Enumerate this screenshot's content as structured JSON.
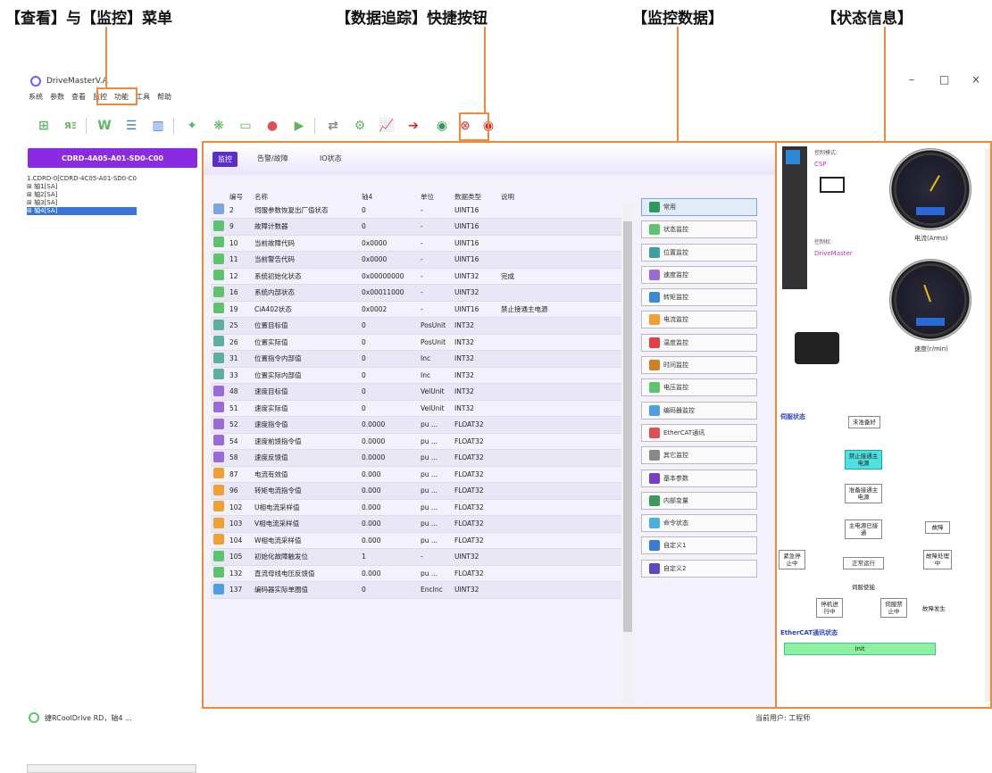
{
  "annotations": {
    "menu": "【查看】与【监控】菜单",
    "trace": "【数据追踪】快捷按钮",
    "monitor": "【监控数据】",
    "status": "【状态信息】"
  },
  "window": {
    "title": "DriveMasterV.A",
    "minimize": "–",
    "maximize": "□",
    "close": "×"
  },
  "menu": [
    "系统",
    "参数",
    "查看",
    "监控",
    "功能",
    "工具",
    "帮助"
  ],
  "device_button": "CDRD-4A05-A01-SD0-C00",
  "tree": {
    "root": "1.CDRD-0[CDRD-4C05-A01-SD0-C0",
    "items": [
      "⊞ 轴1[SA]",
      "⊞ 轴2[SA]",
      "⊞ 轴3[SA]",
      "⊞ 轴4[SA]"
    ]
  },
  "tabs": [
    "监控",
    "告警/故障",
    "IO状态"
  ],
  "table": {
    "headers": [
      "编号",
      "名称",
      "轴4",
      "单位",
      "数据类型",
      "说明"
    ],
    "rows": [
      [
        "2",
        "伺服参数恢复出厂值状态",
        "0",
        "-",
        "UINT16",
        ""
      ],
      [
        "9",
        "故障计数器",
        "0",
        "-",
        "UINT16",
        ""
      ],
      [
        "10",
        "当前故障代码",
        "0x0000",
        "-",
        "UINT16",
        ""
      ],
      [
        "11",
        "当前警告代码",
        "0x0000",
        "-",
        "UINT16",
        ""
      ],
      [
        "12",
        "系统初始化状态",
        "0x00000000",
        "-",
        "UINT32",
        "完成"
      ],
      [
        "16",
        "系统内部状态",
        "0x00011000",
        "-",
        "UINT32",
        ""
      ],
      [
        "19",
        "CiA402状态",
        "0x0002",
        "-",
        "UINT16",
        "禁止接通主电源"
      ],
      [
        "25",
        "位置目标值",
        "0",
        "PosUnit",
        "INT32",
        ""
      ],
      [
        "26",
        "位置实际值",
        "0",
        "PosUnit",
        "INT32",
        ""
      ],
      [
        "31",
        "位置指令内部值",
        "0",
        "Inc",
        "INT32",
        ""
      ],
      [
        "33",
        "位置实际内部值",
        "0",
        "Inc",
        "INT32",
        ""
      ],
      [
        "48",
        "速度目标值",
        "0",
        "VelUnit",
        "INT32",
        ""
      ],
      [
        "51",
        "速度实际值",
        "0",
        "VelUnit",
        "INT32",
        ""
      ],
      [
        "52",
        "速度指令值",
        "0.0000",
        "pu ...",
        "FLOAT32",
        ""
      ],
      [
        "54",
        "速度前馈指令值",
        "0.0000",
        "pu ...",
        "FLOAT32",
        ""
      ],
      [
        "58",
        "速度反馈值",
        "0.0000",
        "pu ...",
        "FLOAT32",
        ""
      ],
      [
        "87",
        "电流有效值",
        "0.000",
        "pu ...",
        "FLOAT32",
        ""
      ],
      [
        "96",
        "转矩电流指令值",
        "0.000",
        "pu ...",
        "FLOAT32",
        ""
      ],
      [
        "102",
        "U相电流采样值",
        "0.000",
        "pu ...",
        "FLOAT32",
        ""
      ],
      [
        "103",
        "V相电流采样值",
        "0.000",
        "pu ...",
        "FLOAT32",
        ""
      ],
      [
        "104",
        "W相电流采样值",
        "0.000",
        "pu ...",
        "FLOAT32",
        ""
      ],
      [
        "105",
        "初始化故障触发位",
        "1",
        "-",
        "UINT32",
        ""
      ],
      [
        "132",
        "直流母线电压反馈值",
        "0.000",
        "pu ...",
        "FLOAT32",
        ""
      ],
      [
        "137",
        "编码器实际单圈值",
        "0",
        "EncInc",
        "UINT32",
        ""
      ]
    ],
    "row_colors": [
      "#7aa7e0",
      "#5cc46a",
      "#5cc46a",
      "#5cc46a",
      "#5cc46a",
      "#5cc46a",
      "#5cc46a",
      "#5cb0a0",
      "#5cb0a0",
      "#5cb0a0",
      "#5cb0a0",
      "#9a6ad8",
      "#9a6ad8",
      "#9a6ad8",
      "#9a6ad8",
      "#9a6ad8",
      "#f0a030",
      "#f0a030",
      "#f0a030",
      "#f0a030",
      "#f0a030",
      "#5cc46a",
      "#5cc46a",
      "#4aa0e0"
    ]
  },
  "monitor_buttons": [
    {
      "label": "常用",
      "color": "#2a9a5a"
    },
    {
      "label": "状态监控",
      "color": "#5cc46a"
    },
    {
      "label": "位置监控",
      "color": "#3aa0a0"
    },
    {
      "label": "速度监控",
      "color": "#9a6ad8"
    },
    {
      "label": "转矩监控",
      "color": "#3a8ad8"
    },
    {
      "label": "电流监控",
      "color": "#f0a030"
    },
    {
      "label": "温度监控",
      "color": "#e04040"
    },
    {
      "label": "时间监控",
      "color": "#d08020"
    },
    {
      "label": "电压监控",
      "color": "#5cc46a"
    },
    {
      "label": "编码器监控",
      "color": "#4aa0e0"
    },
    {
      "label": "EtherCAT通讯",
      "color": "#e05050"
    },
    {
      "label": "其它监控",
      "color": "#888888"
    },
    {
      "label": "基本参数",
      "color": "#7a3ac8"
    },
    {
      "label": "内部变量",
      "color": "#3a9a5a"
    },
    {
      "label": "命令状态",
      "color": "#4ab0e0"
    },
    {
      "label": "自定义1",
      "color": "#3a7ad8"
    },
    {
      "label": "自定义2",
      "color": "#5a4ac8"
    }
  ],
  "status_panel": {
    "control_mode_label": "控制模式:",
    "control_mode": "CSP",
    "control_right_label": "控制权:",
    "control_right": "DriveMaster",
    "gauge1_label": "电流(Arms)",
    "gauge2_label": "速度(r/min)",
    "servo_state_title": "伺服状态",
    "states": [
      "未准备好",
      "禁止接通主电源",
      "准备接通主电源",
      "主电源已接通",
      "正常运行",
      "伺服使能",
      "紧急停止中",
      "故障",
      "故障处理中",
      "停机进行中",
      "伺服禁止中",
      "故障发生"
    ],
    "ethercat_title": "EtherCAT通讯状态",
    "ethercat_state": "Init"
  },
  "statusbar": {
    "left": "捷RCoolDrive RD，轴4 ...",
    "right": "当前用户: 工程师"
  }
}
